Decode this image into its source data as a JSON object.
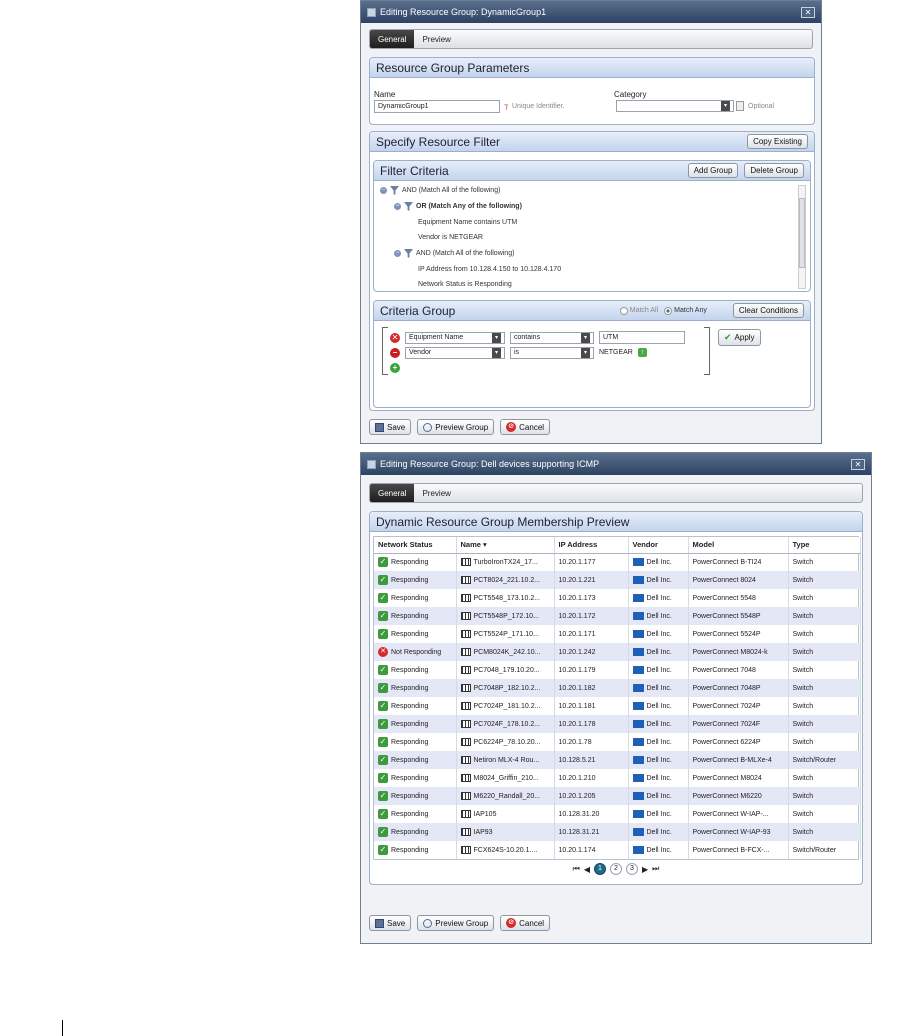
{
  "window1": {
    "title": "Editing Resource Group: DynamicGroup1",
    "tabs": [
      "General",
      "Preview"
    ],
    "params_panel": {
      "title": "Resource Group Parameters",
      "name_label": "Name",
      "name_value": "DynamicGroup1",
      "name_hint": "Unique Identifier.",
      "category_label": "Category",
      "category_hint": "Optional"
    },
    "filter_panel": {
      "title": "Specify Resource Filter",
      "copy_button": "Copy Existing",
      "criteria_title": "Filter Criteria",
      "add_group_button": "Add Group",
      "delete_group_button": "Delete Group",
      "tree": [
        {
          "text": "AND (Match All of the following)",
          "bold": false
        },
        {
          "text": "OR (Match Any of the following)",
          "bold": true
        },
        {
          "text": "Equipment Name contains UTM",
          "bold": false
        },
        {
          "text": "Vendor is NETGEAR",
          "bold": false
        },
        {
          "text": "AND (Match All of the following)",
          "bold": false
        },
        {
          "text": "IP Address from 10.128.4.150 to 10.128.4.170",
          "bold": false
        },
        {
          "text": "Network Status is Responding",
          "bold": false
        }
      ]
    },
    "criteria_group": {
      "title": "Criteria Group",
      "match_all_label": "Match All",
      "match_any_label": "Match Any",
      "selected": "Match Any",
      "clear_button": "Clear Conditions",
      "apply_button": "Apply",
      "conditions": [
        {
          "field": "Equipment Name",
          "operator": "contains",
          "value": "UTM"
        },
        {
          "field": "Vendor",
          "operator": "is",
          "value": "NETGEAR"
        }
      ]
    },
    "footer": {
      "save": "Save",
      "preview": "Preview Group",
      "cancel": "Cancel"
    }
  },
  "window2": {
    "title": "Editing Resource Group: Dell devices supporting ICMP",
    "tabs": [
      "General",
      "Preview"
    ],
    "panel_title": "Dynamic Resource Group Membership Preview",
    "columns": [
      "Network Status",
      "Name",
      "IP Address",
      "Vendor",
      "Model",
      "Type"
    ],
    "sort_indicator": "▾",
    "rows": [
      {
        "status": "Responding",
        "ok": true,
        "name": "TurboIronTX24_17...",
        "ip": "10.20.1.177",
        "vendor": "Dell Inc.",
        "model": "PowerConnect B-TI24",
        "type": "Switch",
        "icon": "switch"
      },
      {
        "status": "Responding",
        "ok": true,
        "name": "PCT8024_221.10.2...",
        "ip": "10.20.1.221",
        "vendor": "Dell Inc.",
        "model": "PowerConnect 8024",
        "type": "Switch",
        "icon": "switch"
      },
      {
        "status": "Responding",
        "ok": true,
        "name": "PCT5548_173.10.2...",
        "ip": "10.20.1.173",
        "vendor": "Dell Inc.",
        "model": "PowerConnect 5548",
        "type": "Switch",
        "icon": "switch"
      },
      {
        "status": "Responding",
        "ok": true,
        "name": "PCT5548P_172.10...",
        "ip": "10.20.1.172",
        "vendor": "Dell Inc.",
        "model": "PowerConnect 5548P",
        "type": "Switch",
        "icon": "switch"
      },
      {
        "status": "Responding",
        "ok": true,
        "name": "PCT5524P_171.10...",
        "ip": "10.20.1.171",
        "vendor": "Dell Inc.",
        "model": "PowerConnect 5524P",
        "type": "Switch",
        "icon": "switch"
      },
      {
        "status": "Not Responding",
        "ok": false,
        "name": "PCM8024K_242.10...",
        "ip": "10.20.1.242",
        "vendor": "Dell Inc.",
        "model": "PowerConnect M8024-k",
        "type": "Switch",
        "icon": "switch"
      },
      {
        "status": "Responding",
        "ok": true,
        "name": "PC7048_179.10.20...",
        "ip": "10.20.1.179",
        "vendor": "Dell Inc.",
        "model": "PowerConnect 7048",
        "type": "Switch",
        "icon": "switch"
      },
      {
        "status": "Responding",
        "ok": true,
        "name": "PC7048P_182.10.2...",
        "ip": "10.20.1.182",
        "vendor": "Dell Inc.",
        "model": "PowerConnect 7048P",
        "type": "Switch",
        "icon": "switch"
      },
      {
        "status": "Responding",
        "ok": true,
        "name": "PC7024P_181.10.2...",
        "ip": "10.20.1.181",
        "vendor": "Dell Inc.",
        "model": "PowerConnect 7024P",
        "type": "Switch",
        "icon": "switch"
      },
      {
        "status": "Responding",
        "ok": true,
        "name": "PC7024F_178.10.2...",
        "ip": "10.20.1.178",
        "vendor": "Dell Inc.",
        "model": "PowerConnect 7024F",
        "type": "Switch",
        "icon": "switch"
      },
      {
        "status": "Responding",
        "ok": true,
        "name": "PC6224P_78.10.20...",
        "ip": "10.20.1.78",
        "vendor": "Dell Inc.",
        "model": "PowerConnect 6224P",
        "type": "Switch",
        "icon": "switch"
      },
      {
        "status": "Responding",
        "ok": true,
        "name": "Netiron MLX-4 Rou...",
        "ip": "10.128.5.21",
        "vendor": "Dell Inc.",
        "model": "PowerConnect B-MLXe-4",
        "type": "Switch/Router",
        "icon": "router"
      },
      {
        "status": "Responding",
        "ok": true,
        "name": "M8024_Griffin_210...",
        "ip": "10.20.1.210",
        "vendor": "Dell Inc.",
        "model": "PowerConnect M8024",
        "type": "Switch",
        "icon": "switch"
      },
      {
        "status": "Responding",
        "ok": true,
        "name": "M6220_Randall_20...",
        "ip": "10.20.1.205",
        "vendor": "Dell Inc.",
        "model": "PowerConnect M6220",
        "type": "Switch",
        "icon": "switch"
      },
      {
        "status": "Responding",
        "ok": true,
        "name": "IAP105",
        "ip": "10.128.31.20",
        "vendor": "Dell Inc.",
        "model": "PowerConnect W-IAP-...",
        "type": "Switch",
        "icon": "wireless"
      },
      {
        "status": "Responding",
        "ok": true,
        "name": "IAP93",
        "ip": "10.128.31.21",
        "vendor": "Dell Inc.",
        "model": "PowerConnect W-IAP-93",
        "type": "Switch",
        "icon": "wireless"
      },
      {
        "status": "Responding",
        "ok": true,
        "name": "FCX624S-10.20.1....",
        "ip": "10.20.1.174",
        "vendor": "Dell Inc.",
        "model": "PowerConnect B-FCX-...",
        "type": "Switch/Router",
        "icon": "router"
      }
    ],
    "pager": {
      "pages": [
        "1",
        "2",
        "3"
      ],
      "current": "1"
    },
    "footer": {
      "save": "Save",
      "preview": "Preview Group",
      "cancel": "Cancel"
    }
  }
}
